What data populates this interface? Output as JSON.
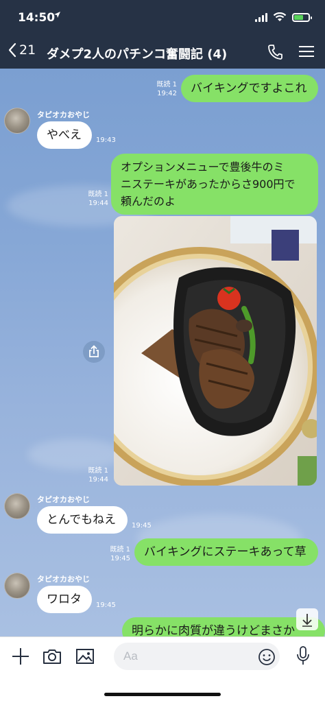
{
  "status_bar": {
    "time": "14:50",
    "location_icon": "location-arrow-icon",
    "battery_level": 0.6
  },
  "nav": {
    "back_count": "21",
    "title": "ダメプ2人のパチンコ奮闘記 (4)"
  },
  "messages": {
    "m1": {
      "text": "バイキングですよこれ",
      "read": "既読 1",
      "time": "19:42"
    },
    "m2": {
      "sender": "タピオカおやじ",
      "text": "やべえ",
      "time": "19:43"
    },
    "m3": {
      "line1": "オプションメニューで豊後牛のミ",
      "line2": "ニステーキがあったからさ900円で",
      "line3": "頼んだのよ",
      "read": "既読 1",
      "time": "19:44"
    },
    "m4": {
      "read": "既読 1",
      "time": "19:44"
    },
    "m5": {
      "sender": "タピオカおやじ",
      "text": "とんでもねえ",
      "time": "19:45"
    },
    "m6": {
      "text": "バイキングにステーキあって草",
      "read": "既読 1",
      "time": "19:45"
    },
    "m7": {
      "sender": "タピオカおやじ",
      "text": "ワロタ",
      "time": "19:45"
    },
    "m8": {
      "text": "明らかに肉質が違うけどまさか"
    }
  },
  "input": {
    "placeholder": "Aa"
  },
  "colors": {
    "nav_bg": "#263245",
    "outgoing_bubble": "#86e167",
    "incoming_bubble": "#ffffff",
    "chat_bg": "#86a7d6"
  }
}
